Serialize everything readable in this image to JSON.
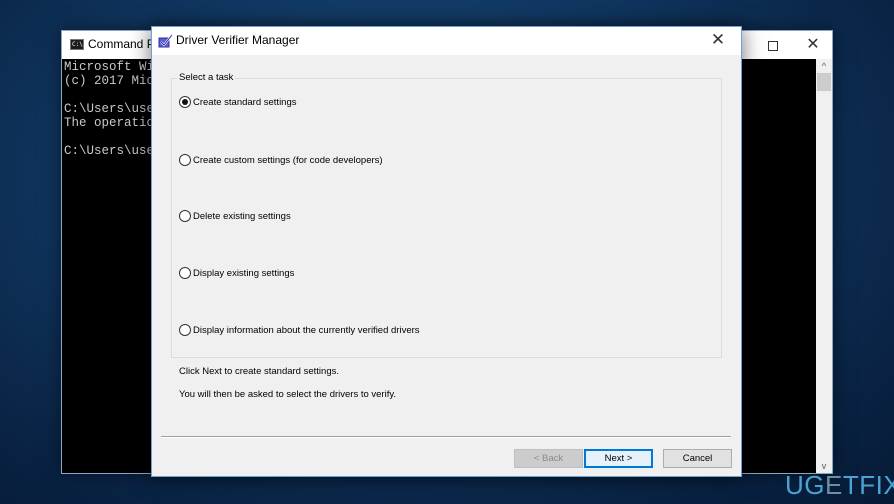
{
  "cmd_window": {
    "title": "Command Prompt",
    "title_visible": "Command Pro",
    "lines": [
      "Microsoft Wind",
      "(c) 2017 Micro",
      "",
      "C:\\Users\\user>",
      "The operation ",
      "",
      "C:\\Users\\user>"
    ],
    "maximize_icon": "maximize-icon",
    "close_icon": "close-icon",
    "scroll_up_glyph": "^",
    "scroll_down_glyph": "v"
  },
  "dialog": {
    "title": "Driver Verifier Manager",
    "close_glyph": "✕",
    "group_label": "Select a task",
    "options": [
      {
        "label": "Create standard settings",
        "selected": true
      },
      {
        "label": "Create custom settings (for code developers)",
        "selected": false
      },
      {
        "label": "Delete existing settings",
        "selected": false
      },
      {
        "label": "Display existing settings",
        "selected": false
      },
      {
        "label": "Display information about the currently verified drivers",
        "selected": false
      }
    ],
    "info_line_1": "Click Next to create standard settings.",
    "info_line_2": "You will then be asked to select the drivers to verify.",
    "buttons": {
      "back": "< Back",
      "next": "Next >",
      "cancel": "Cancel"
    }
  },
  "watermark": {
    "part1": "UG",
    "part2": "E",
    "part3": "TFIX"
  },
  "colors": {
    "accent": "#0078d7",
    "watermark": "#4aa3d4"
  }
}
